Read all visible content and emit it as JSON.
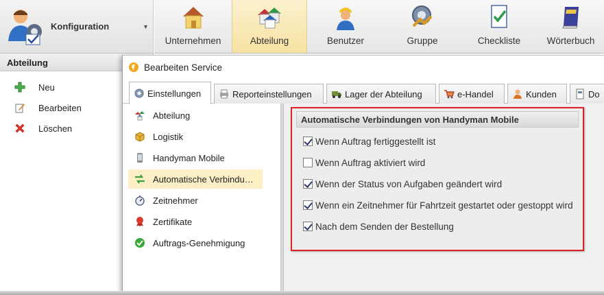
{
  "config": {
    "label": "Konfiguration"
  },
  "ribbon": {
    "buttons": [
      {
        "label": "Unternehmen",
        "icon": "company-house-icon"
      },
      {
        "label": "Abteilung",
        "icon": "department-houses-icon"
      },
      {
        "label": "Benutzer",
        "icon": "user-worker-icon"
      },
      {
        "label": "Gruppe",
        "icon": "group-icon"
      },
      {
        "label": "Checkliste",
        "icon": "checklist-icon"
      },
      {
        "label": "Wörterbuch",
        "icon": "dictionary-icon"
      }
    ],
    "active_index": 1
  },
  "left_panel": {
    "title": "Abteilung",
    "items": [
      {
        "label": "Neu",
        "icon": "plus-icon"
      },
      {
        "label": "Bearbeiten",
        "icon": "edit-icon"
      },
      {
        "label": "Löschen",
        "icon": "delete-icon"
      }
    ]
  },
  "dialog": {
    "title": "Bearbeiten Service",
    "tabs": [
      {
        "label": "Einstellungen",
        "icon": "gear-icon"
      },
      {
        "label": "Reporteinstellungen",
        "icon": "printer-icon"
      },
      {
        "label": "Lager der Abteilung",
        "icon": "truck-icon"
      },
      {
        "label": "e-Handel",
        "icon": "cart-icon"
      },
      {
        "label": "Kunden",
        "icon": "customer-icon"
      },
      {
        "label": "Do",
        "icon": "document-icon"
      }
    ],
    "nav": [
      {
        "label": "Abteilung",
        "icon": "department-icon"
      },
      {
        "label": "Logistik",
        "icon": "box-icon"
      },
      {
        "label": "Handyman Mobile",
        "icon": "mobile-icon"
      },
      {
        "label": "Automatische Verbindu…",
        "icon": "sync-arrows-icon"
      },
      {
        "label": "Zeitnehmer",
        "icon": "stopwatch-icon"
      },
      {
        "label": "Zertifikate",
        "icon": "ribbon-award-icon"
      },
      {
        "label": "Auftrags-Genehmigung",
        "icon": "check-circle-icon"
      }
    ],
    "nav_selected_index": 3,
    "group": {
      "title": "Automatische Verbindungen von Handyman Mobile",
      "options": [
        {
          "label": "Wenn Auftrag fertiggestellt ist",
          "checked": true
        },
        {
          "label": "Wenn Auftrag aktiviert wird",
          "checked": false
        },
        {
          "label": "Wenn der Status von Aufgaben geändert wird",
          "checked": true
        },
        {
          "label": "Wenn ein Zeitnehmer für Fahrtzeit gestartet oder gestoppt wird",
          "checked": true
        },
        {
          "label": "Nach dem Senden der Bestellung",
          "checked": true
        }
      ]
    }
  },
  "colors": {
    "highlight_border": "#e01f24",
    "selected_bg": "#fcefc6",
    "ribbon_active": "#f6e2a2"
  }
}
